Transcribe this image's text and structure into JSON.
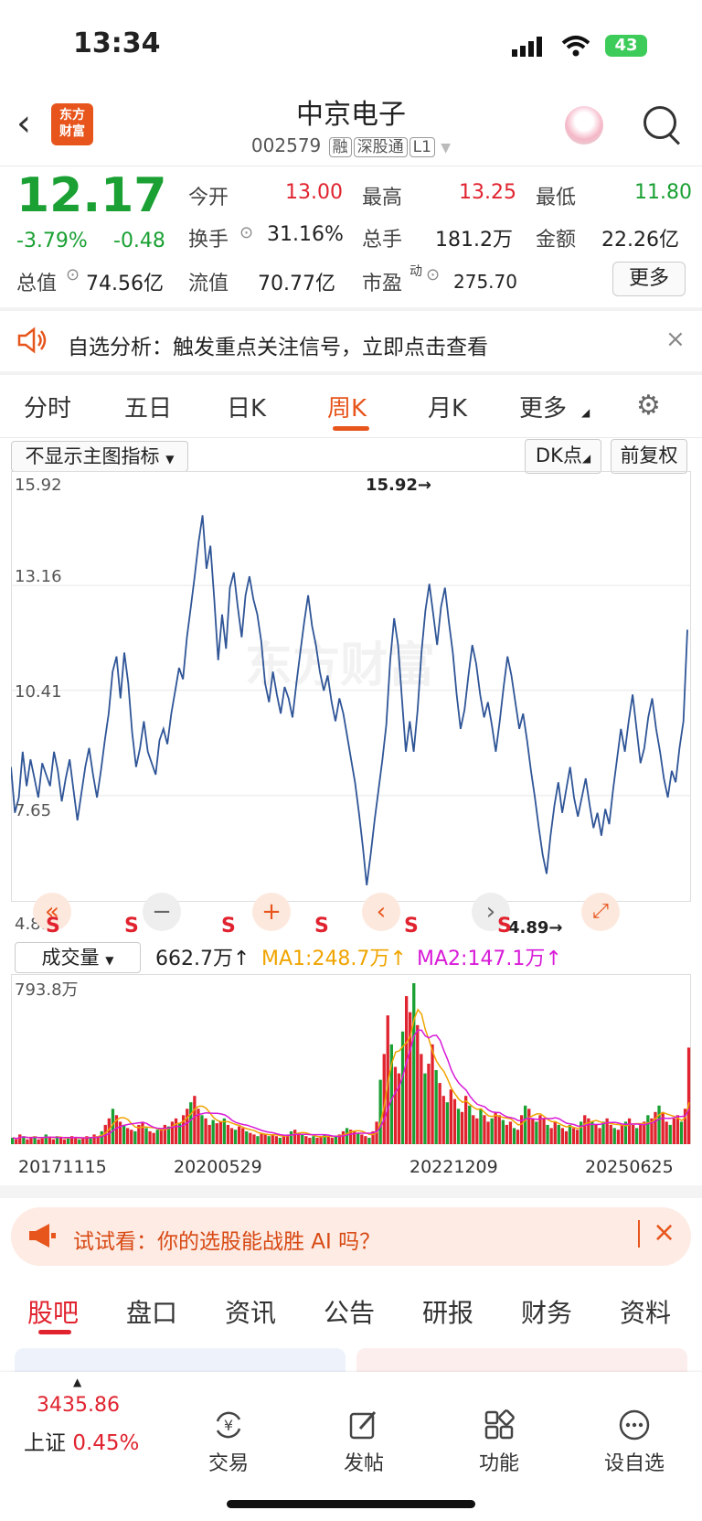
{
  "status_bar": {
    "time": "13:34",
    "battery": "43"
  },
  "header": {
    "logo_line1": "东方",
    "logo_line2": "财富",
    "title": "中京电子",
    "code": "002579",
    "tags": [
      "融",
      "深股通",
      "L1"
    ]
  },
  "quote": {
    "price": "12.17",
    "change_pct": "-3.79%",
    "change": "-0.48",
    "rows": [
      {
        "label": "今开",
        "value": "13.00",
        "label2": "最高",
        "value2": "13.25",
        "label3": "最低",
        "value3": "11.80"
      },
      {
        "label": "换手",
        "value": "31.16%",
        "label2": "总手",
        "value2": "181.2万",
        "label3": "金额",
        "value3": "22.26亿"
      },
      {
        "label": "总值",
        "value": "74.56亿",
        "label2": "流值",
        "value2": "70.77亿",
        "label3": "市盈",
        "label3_sup": "动",
        "value3": "275.70"
      }
    ],
    "more_label": "更多"
  },
  "notice": {
    "text": "自选分析：触发重点关注信号，立即点击查看"
  },
  "tabs": [
    "分时",
    "五日",
    "日K",
    "周K",
    "月K",
    "更多"
  ],
  "active_tab": "周K",
  "chart_controls": {
    "indicator_select": "不显示主图指标",
    "dk_label": "DK点",
    "adjust_label": "前复权"
  },
  "chart_data": {
    "type": "line",
    "title": "",
    "y_ticks": [
      "15.92",
      "13.16",
      "10.41",
      "7.65",
      "4.89"
    ],
    "ylim": [
      4.89,
      15.92
    ],
    "max_label": "15.92→",
    "min_label": "4.89→",
    "x_ticks": [
      "20171115",
      "20200529",
      "20221209",
      "20250625"
    ],
    "series": [
      {
        "values": [
          8.4,
          7.2,
          7.6,
          8.8,
          7.9,
          8.6,
          8.1,
          7.6,
          8.5,
          8.2,
          7.9,
          8.8,
          8.3,
          7.5,
          8.1,
          8.6,
          7.8,
          7.0,
          7.7,
          8.4,
          8.9,
          8.2,
          7.6,
          8.3,
          9.1,
          9.8,
          10.9,
          11.3,
          10.2,
          11.4,
          10.6,
          9.3,
          8.4,
          8.9,
          9.6,
          8.8,
          8.5,
          8.2,
          9.1,
          9.4,
          9.0,
          9.8,
          10.4,
          11.0,
          10.7,
          11.8,
          12.6,
          13.4,
          14.3,
          15.0,
          13.6,
          14.2,
          12.8,
          11.2,
          12.4,
          11.5,
          13.1,
          13.5,
          12.6,
          11.8,
          12.9,
          13.4,
          12.8,
          12.4,
          11.7,
          10.6,
          10.1,
          10.9,
          10.3,
          9.8,
          10.5,
          10.2,
          9.7,
          10.6,
          11.4,
          12.2,
          12.9,
          12.1,
          11.6,
          10.9,
          10.4,
          10.8,
          10.1,
          9.6,
          10.2,
          9.8,
          9.2,
          8.6,
          8.0,
          7.2,
          6.3,
          5.3,
          6.1,
          7.0,
          7.8,
          8.6,
          9.5,
          11.2,
          12.3,
          11.6,
          10.2,
          8.8,
          9.6,
          8.8,
          9.9,
          11.4,
          12.5,
          13.2,
          12.4,
          11.6,
          12.6,
          13.1,
          12.2,
          11.4,
          10.3,
          9.4,
          9.9,
          10.8,
          11.6,
          11.1,
          10.3,
          9.7,
          10.1,
          9.5,
          8.8,
          9.6,
          10.5,
          11.3,
          10.8,
          10.1,
          9.4,
          9.8,
          9.1,
          8.3,
          7.6,
          6.8,
          6.1,
          5.6,
          6.6,
          7.4,
          8.0,
          7.2,
          7.8,
          8.4,
          7.6,
          7.1,
          7.6,
          8.1,
          7.4,
          6.8,
          7.2,
          6.6,
          7.3,
          6.9,
          7.8,
          8.6,
          9.4,
          8.8,
          9.6,
          10.3,
          9.4,
          8.5,
          8.9,
          9.7,
          10.2,
          9.4,
          8.8,
          8.1,
          7.6,
          8.3,
          8.0,
          8.9,
          9.6,
          12.0
        ]
      }
    ]
  },
  "volume": {
    "select_label": "成交量",
    "value": "662.7万",
    "ma1": "MA1:248.7万",
    "ma2": "MA2:147.1万",
    "max_label": "793.8万",
    "bars": [
      4,
      3,
      6,
      5,
      3,
      4,
      5,
      3,
      4,
      6,
      4,
      3,
      5,
      4,
      3,
      4,
      5,
      4,
      3,
      4,
      5,
      4,
      6,
      5,
      8,
      12,
      16,
      22,
      18,
      14,
      12,
      10,
      9,
      8,
      12,
      14,
      10,
      8,
      7,
      9,
      10,
      12,
      11,
      14,
      16,
      13,
      18,
      22,
      26,
      30,
      22,
      18,
      16,
      12,
      15,
      13,
      14,
      16,
      12,
      10,
      9,
      11,
      10,
      8,
      7,
      6,
      5,
      7,
      6,
      5,
      6,
      5,
      4,
      5,
      6,
      8,
      9,
      7,
      6,
      5,
      4,
      5,
      4,
      5,
      6,
      5,
      4,
      5,
      6,
      8,
      10,
      9,
      8,
      7,
      6,
      5,
      4,
      8,
      14,
      40,
      56,
      80,
      62,
      48,
      44,
      70,
      92,
      82,
      100,
      74,
      56,
      44,
      50,
      62,
      46,
      38,
      30,
      26,
      34,
      28,
      22,
      20,
      30,
      24,
      18,
      16,
      22,
      18,
      14,
      16,
      20,
      18,
      15,
      12,
      14,
      10,
      9,
      18,
      24,
      22,
      16,
      14,
      18,
      16,
      12,
      10,
      14,
      12,
      10,
      8,
      12,
      10,
      9,
      14,
      18,
      16,
      14,
      12,
      10,
      14,
      16,
      12,
      10,
      9,
      12,
      14,
      16,
      12,
      10,
      12,
      14,
      18,
      16,
      20,
      24,
      20,
      14,
      12,
      16,
      18,
      14,
      22,
      60
    ],
    "bar_colors": [
      "up",
      "down"
    ]
  },
  "ai_banner": {
    "text": "试试看：你的选股能战胜 AI 吗？"
  },
  "bottom_tabs": [
    "股吧",
    "盘口",
    "资讯",
    "公告",
    "研报",
    "财务",
    "资料"
  ],
  "active_bottom_tab": "股吧",
  "bottom_nav": {
    "index_value": "3435.86",
    "index_name": "上证",
    "index_change": "0.45%",
    "items": [
      {
        "label": "交易",
        "icon": "yen-exchange-icon"
      },
      {
        "label": "发帖",
        "icon": "edit-icon"
      },
      {
        "label": "功能",
        "icon": "grid-icon"
      },
      {
        "label": "设自选",
        "icon": "more-dots-icon"
      }
    ]
  }
}
